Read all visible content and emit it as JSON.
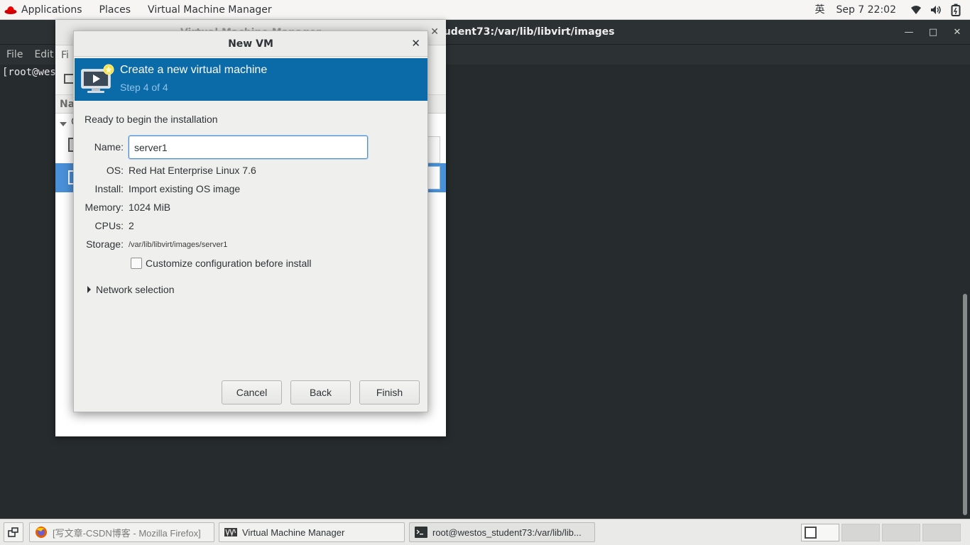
{
  "top_panel": {
    "applications": "Applications",
    "places": "Places",
    "active_app": "Virtual Machine Manager",
    "input_method": "英",
    "datetime": "Sep 7  22:02"
  },
  "terminal": {
    "title": "root@westos_student73:/var/lib/libvirt/images",
    "menu": [
      "File",
      "Edit"
    ],
    "prompt": "[root@wes"
  },
  "vmm": {
    "title": "Virtual Machine Manager",
    "menu_partial": "Fi",
    "col_partial": "Na",
    "group_partial": "Q"
  },
  "dialog": {
    "title": "New VM",
    "banner_title": "Create a new virtual machine",
    "banner_step": "Step 4 of 4",
    "ready_text": "Ready to begin the installation",
    "name_label": "Name:",
    "name_value": "server1",
    "os_label": "OS:",
    "os_value": "Red Hat Enterprise Linux 7.6",
    "install_label": "Install:",
    "install_value": "Import existing OS image",
    "memory_label": "Memory:",
    "memory_value": "1024 MiB",
    "cpus_label": "CPUs:",
    "cpus_value": "2",
    "storage_label": "Storage:",
    "storage_value": "/var/lib/libvirt/images/server1",
    "customize_label": "Customize configuration before install",
    "customize_checked": false,
    "network_label": "Network selection",
    "cancel": "Cancel",
    "back": "Back",
    "finish": "Finish"
  },
  "taskbar": {
    "tasks": [
      {
        "label": "[写文章-CSDN博客 - Mozilla Firefox]",
        "icon": "firefox-icon"
      },
      {
        "label": "Virtual Machine Manager",
        "icon": "vmm-icon"
      },
      {
        "label": "root@westos_student73:/var/lib/lib...",
        "icon": "terminal-icon"
      }
    ]
  },
  "colors": {
    "banner": "#0b6aa8",
    "banner_sub": "#8fc3e7",
    "selection": "#4a90d9",
    "terminal_bg": "#262b2d"
  }
}
